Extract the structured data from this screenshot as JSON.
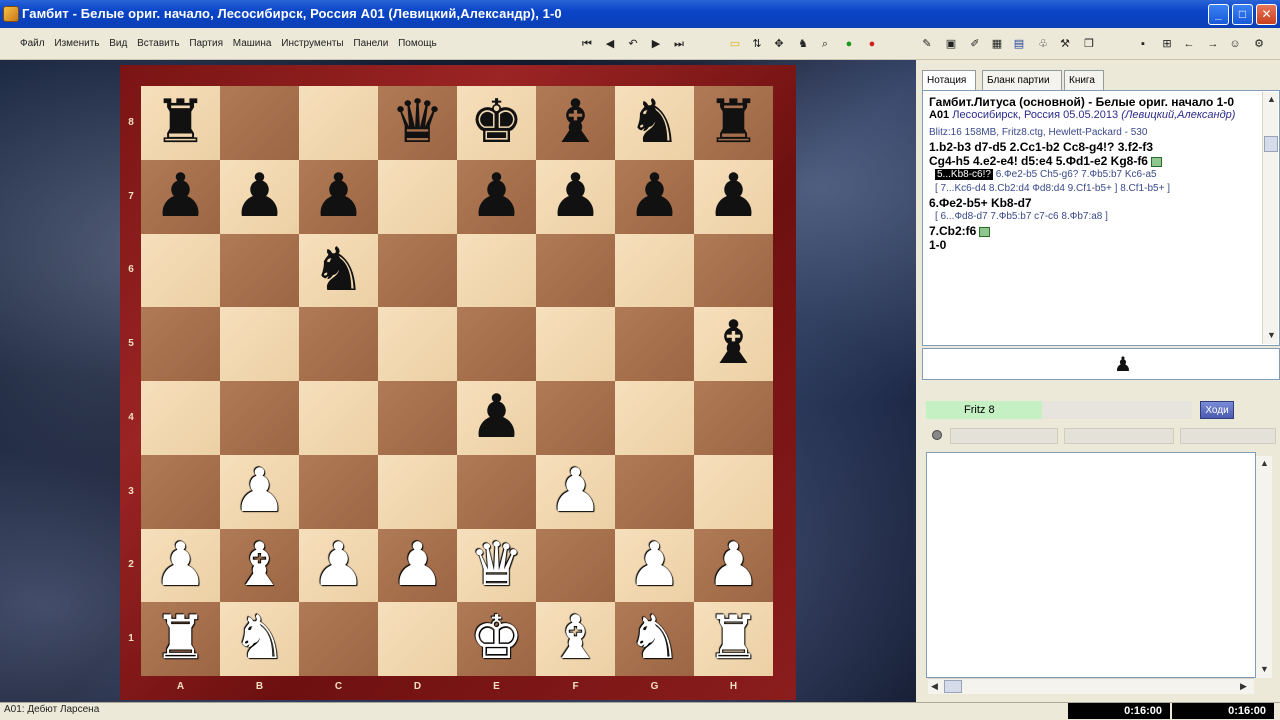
{
  "window": {
    "title": "Гамбит - Белые ориг. начало, Лесосибирск, Россия  A01  (Левицкий,Александр), 1-0",
    "min_label": "_",
    "max_label": "□",
    "close_label": "✕"
  },
  "menu": [
    "Файл",
    "Изменить",
    "Вид",
    "Вставить",
    "Партия",
    "Машина",
    "Инструменты",
    "Панели",
    "Помощь"
  ],
  "nav_icons": [
    "first-move-icon",
    "prev-move-icon",
    "undo-icon",
    "next-move-icon",
    "last-move-icon"
  ],
  "board": {
    "ranks": [
      "8",
      "7",
      "6",
      "5",
      "4",
      "3",
      "2",
      "1"
    ],
    "files": [
      "A",
      "B",
      "C",
      "D",
      "E",
      "F",
      "G",
      "H"
    ],
    "pieces": [
      {
        "sq": "a8",
        "color": "black",
        "type": "rook"
      },
      {
        "sq": "d8",
        "color": "black",
        "type": "queen"
      },
      {
        "sq": "e8",
        "color": "black",
        "type": "king"
      },
      {
        "sq": "f8",
        "color": "black",
        "type": "bishop"
      },
      {
        "sq": "g8",
        "color": "black",
        "type": "knight"
      },
      {
        "sq": "h8",
        "color": "black",
        "type": "rook"
      },
      {
        "sq": "a7",
        "color": "black",
        "type": "pawn"
      },
      {
        "sq": "b7",
        "color": "black",
        "type": "pawn"
      },
      {
        "sq": "c7",
        "color": "black",
        "type": "pawn"
      },
      {
        "sq": "e7",
        "color": "black",
        "type": "pawn"
      },
      {
        "sq": "f7",
        "color": "black",
        "type": "pawn"
      },
      {
        "sq": "g7",
        "color": "black",
        "type": "pawn"
      },
      {
        "sq": "h7",
        "color": "black",
        "type": "pawn"
      },
      {
        "sq": "c6",
        "color": "black",
        "type": "knight"
      },
      {
        "sq": "h5",
        "color": "black",
        "type": "bishop"
      },
      {
        "sq": "e4",
        "color": "black",
        "type": "pawn"
      },
      {
        "sq": "b3",
        "color": "white",
        "type": "pawn"
      },
      {
        "sq": "f3",
        "color": "white",
        "type": "pawn"
      },
      {
        "sq": "a2",
        "color": "white",
        "type": "pawn"
      },
      {
        "sq": "b2",
        "color": "white",
        "type": "bishop"
      },
      {
        "sq": "c2",
        "color": "white",
        "type": "pawn"
      },
      {
        "sq": "d2",
        "color": "white",
        "type": "pawn"
      },
      {
        "sq": "e2",
        "color": "white",
        "type": "queen"
      },
      {
        "sq": "g2",
        "color": "white",
        "type": "pawn"
      },
      {
        "sq": "h2",
        "color": "white",
        "type": "pawn"
      },
      {
        "sq": "a1",
        "color": "white",
        "type": "rook"
      },
      {
        "sq": "b1",
        "color": "white",
        "type": "knight"
      },
      {
        "sq": "e1",
        "color": "white",
        "type": "king"
      },
      {
        "sq": "f1",
        "color": "white",
        "type": "bishop"
      },
      {
        "sq": "g1",
        "color": "white",
        "type": "knight"
      },
      {
        "sq": "h1",
        "color": "white",
        "type": "rook"
      }
    ]
  },
  "tabs": [
    "Нотация",
    "Бланк партии",
    "Книга"
  ],
  "notation": {
    "header": "Гамбит.Литуса (основной) - Белые ориг. начало  1-0",
    "eco": "A01",
    "event": "Лесосибирск, Россия 05.05.2013",
    "players": "(Левицкий,Александр)",
    "info": "Blitz:16  158MB, Fritz8.ctg, Hewlett-Packard - 530",
    "line1": "1.b2-b3  d7-d5  2.Cc1-b2  Cc8-g4!?  3.f2-f3",
    "line2": "Cg4-h5  4.e2-e4!  d5:e4  5.Фd1-e2  Kg8-f6",
    "var1_hl": "5...Kb8-c6!?",
    "var1_rest": "6.Фe2-b5  Ch5-g6?  7.Фb5:b7  Kc6-a5",
    "var2": "[ 7...Kc6-d4  8.Cb2:d4  Фd8:d4  9.Cf1-b5+ ] 8.Cf1-b5+ ]",
    "line3": "6.Фe2-b5+  Kb8-d7",
    "var3": "[ 6...Фd8-d7  7.Фb5:b7  c7-c6  8.Фb7:a8 ]",
    "line4": "7.Cb2:f6",
    "result": "1-0"
  },
  "move_indicator": "♟",
  "engine": {
    "name": "Fritz 8",
    "button": "Ходи"
  },
  "status": {
    "text": "A01: Дебют Ларсена",
    "clock_white": "0:16:00",
    "clock_black": "0:16:00"
  }
}
